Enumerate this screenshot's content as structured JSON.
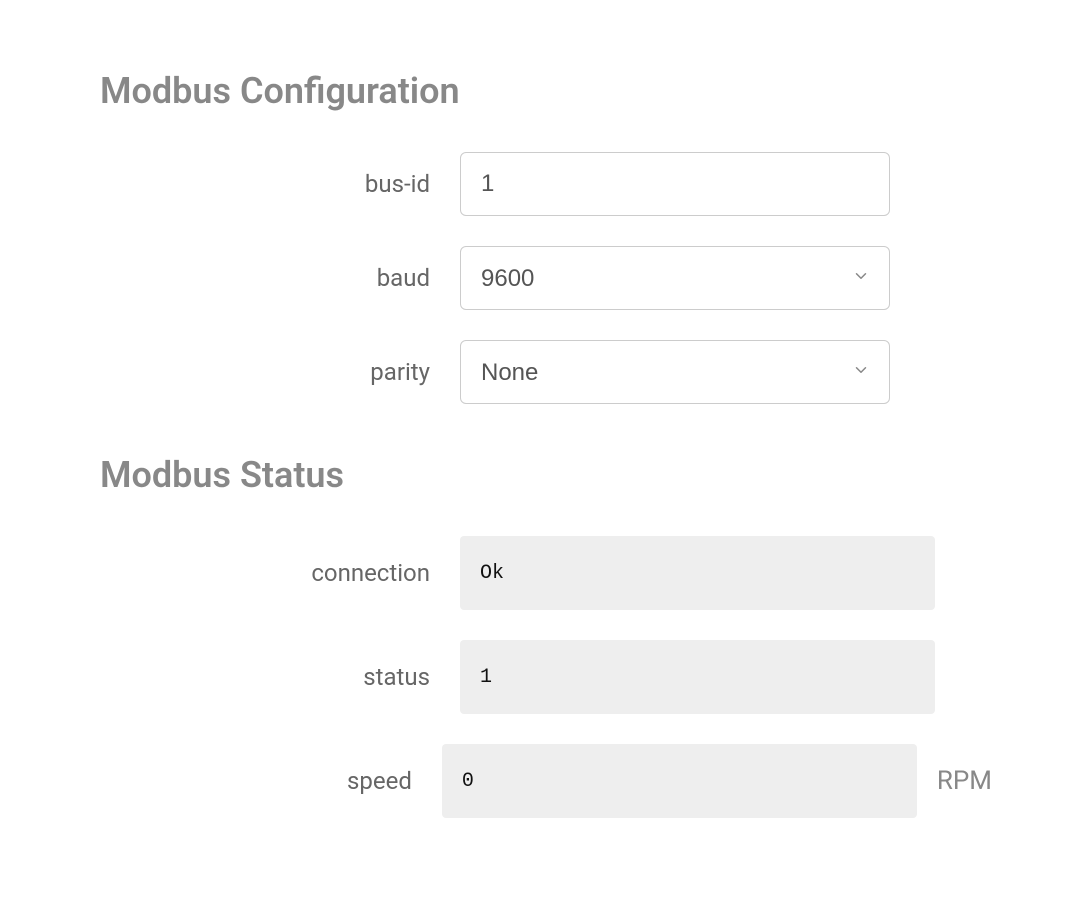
{
  "config": {
    "heading": "Modbus Configuration",
    "fields": {
      "bus_id": {
        "label": "bus-id",
        "value": "1"
      },
      "baud": {
        "label": "baud",
        "value": "9600"
      },
      "parity": {
        "label": "parity",
        "value": "None"
      }
    }
  },
  "status": {
    "heading": "Modbus Status",
    "fields": {
      "connection": {
        "label": "connection",
        "value": "Ok"
      },
      "status": {
        "label": "status",
        "value": "1"
      },
      "speed": {
        "label": "speed",
        "value": "0",
        "unit": "RPM"
      }
    }
  }
}
